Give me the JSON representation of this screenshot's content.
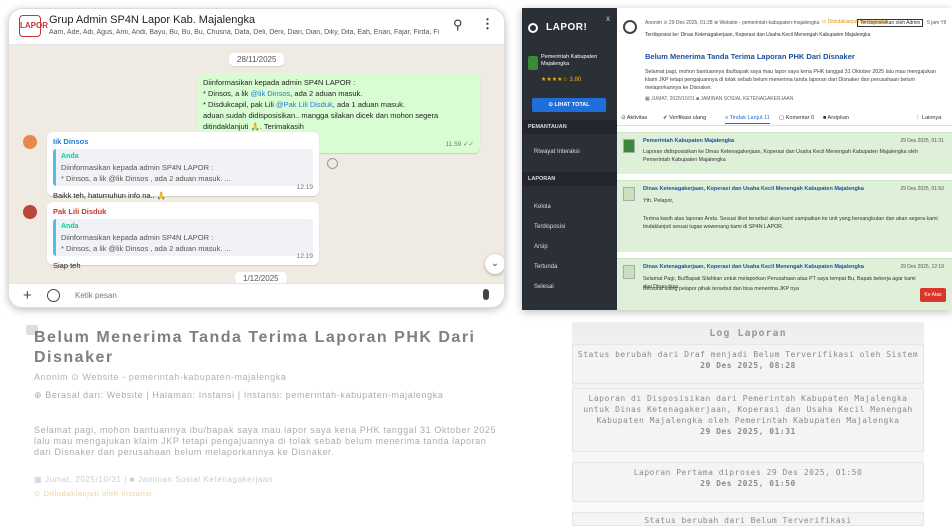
{
  "whatsapp": {
    "group_title": "Grup Admin SP4N Lapor Kab. Majalengka",
    "members": "Aam, Ade, Adi, Agus, Ami, Andi, Bayu, Bu, Bu, Bu, Chusna, Dafa, Deli, Deni, Dian, Dian, Diky, Dita, Eah, Enan, Fajar, Firda, Fir...",
    "date1": "28/11/2025",
    "out_msg": {
      "line1": "Diinformasikan kepada admin SP4N LAPOR :",
      "line2_pre": "* Dinsos, a lik ",
      "line2_mention": "@lik Dinsos",
      "line2_post": ", ada 2 aduan masuk.",
      "line3_pre": "* Disdukcapil, pak Lili ",
      "line3_mention": "@Pak Lili Disduk",
      "line3_post": ", ada 1 aduan masuk.",
      "line4": "aduan sudah didisposisikan.. mangga silakan dicek dan mohon segera ditindaklanjuti 🙏. Terimakasih",
      "time": "11.59 ✓✓"
    },
    "in1": {
      "sender": "Iik Dinsos",
      "quote_name": "Anda",
      "quote_l1": "Diinformasikan kepada admin SP4N LAPOR :",
      "quote_l2": "* Dinsos, a lik @lik Dinsos , ada 2 aduan masuk. ...",
      "text": "Baikk teh, haturnuhun info na.. 🙏",
      "time": "12.19"
    },
    "in2": {
      "sender": "Pak Lili Disduk",
      "quote_name": "Anda",
      "quote_l1": "Diinformasikan kepada admin SP4N LAPOR :",
      "quote_l2": "* Dinsos, a lik @lik Dinsos , ada 2 aduan masuk. ...",
      "text": "Siap teh",
      "time": "12.19"
    },
    "date2": "1/12/2025",
    "input_placeholder": "Ketik pesan"
  },
  "lapor": {
    "logo": "LAPOR!",
    "close": "x",
    "org_name": "Pemerintah Kabupaten Majalengka",
    "rating": "★★★★☆ 3.80",
    "total_btn": "⊙ LIHAT TOTAL",
    "sec1": "PEMANTAUAN",
    "item_riwayat": "Riwayat Interaksi",
    "sec2": "LAPORAN",
    "items": [
      "Kelola",
      "Terdisposisi",
      "Arsip",
      "Tertunda",
      "Selesai"
    ],
    "meta": "Anonim ⊙ 29 Des 2025, 01:28   ⊕ Website - pemerintah-kabupaten-majalengka",
    "badge1": "⊙ Ditindaklanjuti oleh Instansi",
    "badge2": "Terdisposisikan oleh Admin",
    "date_top": "5 jam Yll",
    "meta2": "Terdisposisi ke: Dinas Ketenagakerjaan, Koperasi dan Usaha Kecil Menengah Kabupaten Majalengka",
    "title": "Belum Menerima Tanda Terima Laporan PHK Dari Disnaker",
    "desc": "Selamat pagi, mohon bantuannya ibu/bapak saya mau lapor saya kena PHK tanggal 31 Oktober 2025 lalu mau mengajukan klaim JKP tetapi pengajuannya di tolak sebab belum menerima tanda laporan dari Disnaker dan perusahaan belum melaporkannya ke Disnaker.",
    "tags": "▦ JUMAT, 2025/10/31   ■ JAMINAN SOSIAL KETENAGAKERJAAN",
    "tabs": [
      "⊙ Aktivitas",
      "✔ Verifikasi ulang",
      "≡ Tindak Lanjut 11",
      "▢ Komentar 0",
      "■ Arsipkan",
      "⋮ Lainnya"
    ],
    "card1": {
      "from": "Pemerintah Kabupaten Majalengka",
      "date": "29 Des 2025, 01:31",
      "text": "Laporan didisposisikan ke Dinas Ketenagakerjaan, Koperasi dan Usaha Kecil Menengah Kabupaten Majalengka oleh Pemerintah Kabupaten Majalengka"
    },
    "card2": {
      "from": "Dinas Ketenagakerjaan, Koperasi dan Usaha Kecil Menengah Kabupaten Majalengka",
      "date": "29 Des 2025, 01:50",
      "l1": "Yth. Pelapor,",
      "l2": "Terima kasih atas laporan Anda. Sesuai tiket tersebut akan kami sampaikan ke unit yang bersangkutan dan akan segera kami tindaklanjuti sesuai tugas wewenang kami di SP4N LAPOR."
    },
    "card3": {
      "from": "Dinas Ketenagakerjaan, Koperasi dan Usaha Kecil Menengah Kabupaten Majalengka",
      "date": "29 Des 2025, 12:19",
      "l1": "Selamat Pagi, Bu/Bapak Silahkan untuk melaporkan Perusahaan atau PT saya tempat Bu, Bapak bekerja agar kami dari Dinas bisa",
      "l2": "Bersurat ulang pelapor pihak tersebut dan bisa menerima JKP nya"
    },
    "red_btn": "Ke Atas"
  },
  "reflection_left": {
    "title": "Belum Menerima Tanda Terima Laporan PHK Dari Disnaker",
    "sub": "Anonim ⊙ Website - pemerintah-kabupaten-majalengka",
    "src": "⊕ Berasal dari: Website | Halaman: Instansi | Instansi: pemerintah-kabupaten-majalengka",
    "body": "Selamat pagi, mohon bantuannya ibu/bapak saya mau lapor saya kena PHK tanggal 31 Oktober 2025 lalu mau mengajukan klaim JKP tetapi pengajuannya di tolak sebab belum menerima tanda laporan dari Disnaker dan perusahaan belum melaporkannya ke Disnaker.",
    "footer": "▦ Jumat, 2025/10/31 | ■ Jaminan Sosial Ketenagakerjaan",
    "fb": "⊙ Ditindaklanjuti oleh Instansi"
  },
  "reflection_right": {
    "heading": "Log Laporan",
    "log1": "Status berubah dari Draf menjadi Belum Terverifikasi oleh Sistem",
    "log1_date": "20 Des 2025, 08:28",
    "log2": "Laporan di Disposisikan dari Pemerintah Kabupaten Majalengka untuk Dinas Ketenagakerjaan, Koperasi dan Usaha Kecil Menengah Kabupaten Majalengka oleh Pemerintah Kabupaten Majalengka",
    "log2_date": "29 Des 2025, 01:31",
    "log3": "Laporan Pertama diproses 29 Des 2025, 01:50",
    "log3_date": "29 Des 2025, 01:50",
    "log4": "Status berubah dari Belum Terverifikasi"
  }
}
